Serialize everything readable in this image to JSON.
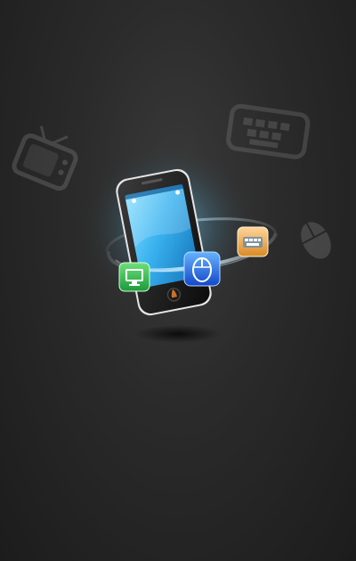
{
  "splash": {
    "accent_colors": {
      "screen": "#3ab3f0",
      "ring": "#bfe9ff",
      "display_app": "#2fb24a",
      "mouse_app": "#2f6fe8",
      "keyboard_app": "#f1b45a"
    },
    "background_icons": [
      "tv-icon",
      "keyboard-icon",
      "mouse-icon"
    ],
    "app_icons": [
      "display-app-icon",
      "mouse-app-icon",
      "keyboard-app-icon"
    ]
  }
}
